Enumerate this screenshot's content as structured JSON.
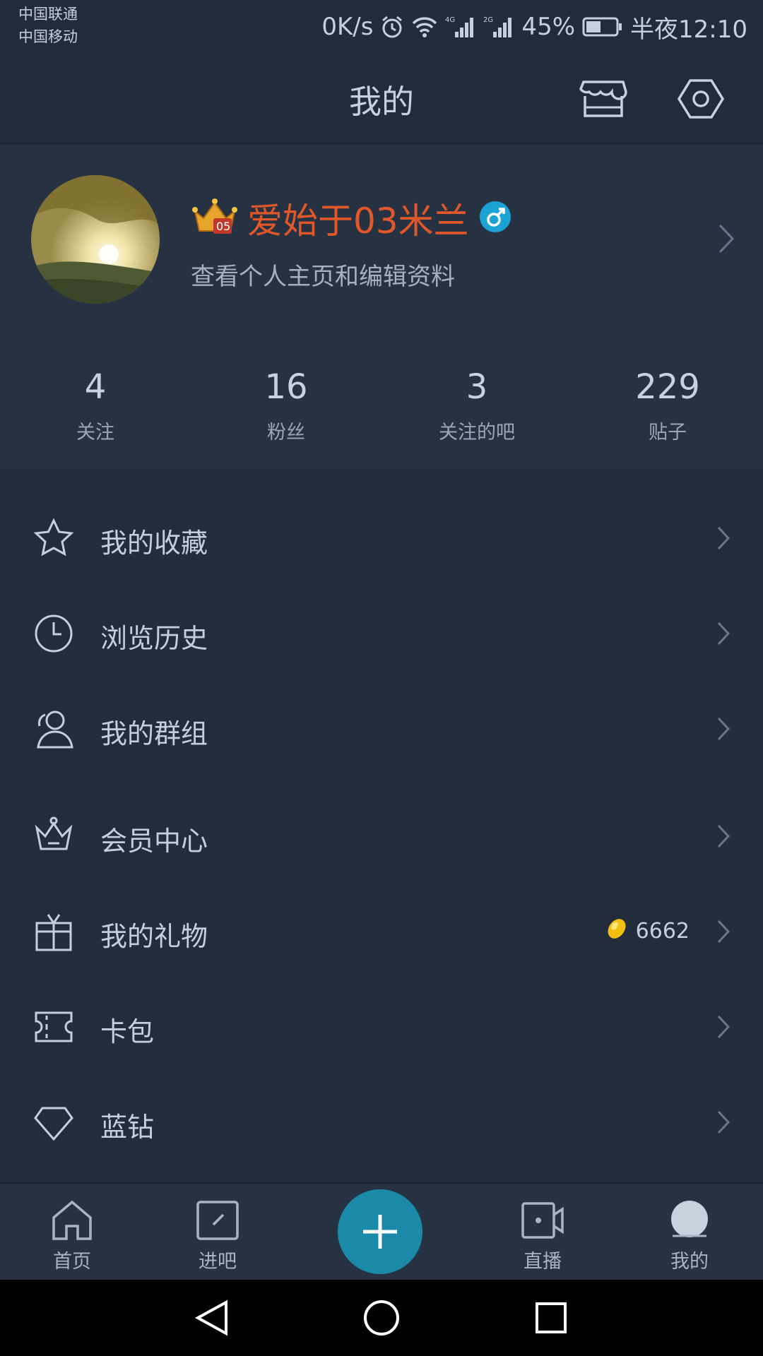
{
  "status_bar": {
    "carrier_1": "中国联通",
    "carrier_2": "中国移动",
    "speed": "0K/s",
    "battery": "45%",
    "time": "半夜12:10"
  },
  "header": {
    "title": "我的",
    "store_icon": "store-icon",
    "settings_icon": "hexagon-settings-icon"
  },
  "profile": {
    "username": "爱始于03米兰",
    "subtitle": "查看个人主页和编辑资料",
    "stats": [
      {
        "value": "4",
        "label": "关注"
      },
      {
        "value": "16",
        "label": "粉丝"
      },
      {
        "value": "3",
        "label": "关注的吧"
      },
      {
        "value": "229",
        "label": "贴子"
      }
    ]
  },
  "menu": [
    {
      "label": "我的收藏",
      "icon": "star-icon"
    },
    {
      "label": "浏览历史",
      "icon": "clock-icon"
    },
    {
      "label": "我的群组",
      "icon": "group-icon"
    },
    {
      "label": "会员中心",
      "icon": "crown-icon"
    },
    {
      "label": "我的礼物",
      "icon": "gift-icon",
      "count": "6662"
    },
    {
      "label": "卡包",
      "icon": "ticket-icon"
    },
    {
      "label": "蓝钻",
      "icon": "diamond-icon"
    }
  ],
  "bottom_nav": [
    {
      "label": "首页",
      "icon": "home-icon"
    },
    {
      "label": "进吧",
      "icon": "enter-bar-icon"
    },
    {
      "label": "直播",
      "icon": "live-camera-icon"
    },
    {
      "label": "我的",
      "icon": "profile-icon"
    }
  ],
  "colors": {
    "background": "#222c3b",
    "username": "#e0572a",
    "fab": "#1a8aa8"
  }
}
